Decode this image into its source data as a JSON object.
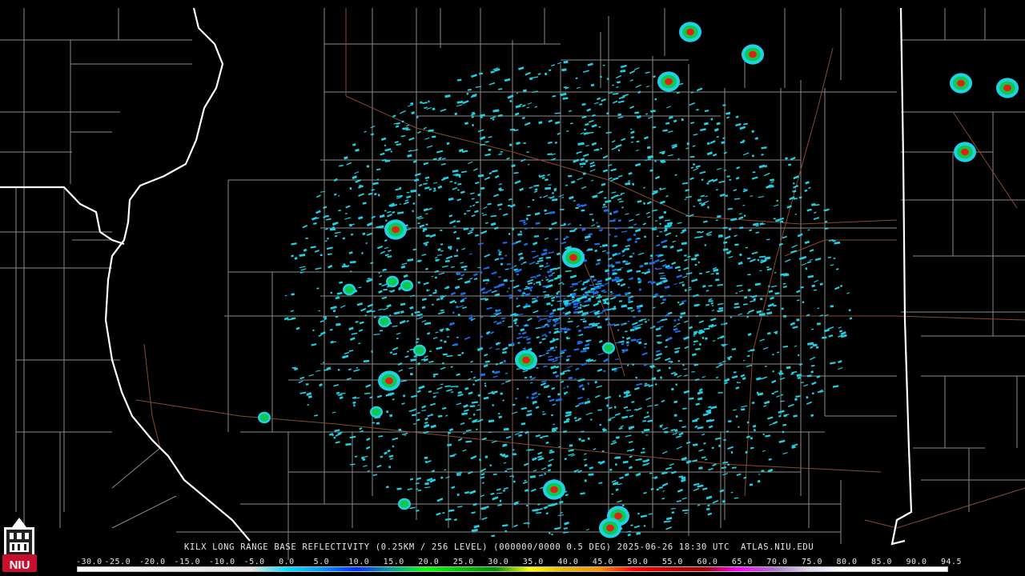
{
  "product": {
    "caption": "KILX LONG RANGE BASE REFLECTIVITY (0.25KM / 256 LEVEL) (000000/0000 0.5 DEG) 2025-06-26 18:30 UTC  ATLAS.NIU.EDU"
  },
  "logo": {
    "text": "NIU",
    "color": "#c8102e"
  },
  "colorbar": {
    "ticks": [
      "-30.0",
      "-25.0",
      "-20.0",
      "-15.0",
      "-10.0",
      "-5.0",
      "0.0",
      "5.0",
      "10.0",
      "15.0",
      "20.0",
      "25.0",
      "30.0",
      "35.0",
      "40.0",
      "45.0",
      "50.0",
      "55.0",
      "60.0",
      "65.0",
      "70.0",
      "75.0",
      "80.0",
      "85.0",
      "90.0",
      "94.5"
    ],
    "stops": [
      "#ffffff",
      "#f5f5f5",
      "#f0f0f0",
      "#ebebeb",
      "#e8e8e8",
      "#e5e5e5",
      "#00e0ff",
      "#009cff",
      "#0030ff",
      "#00a0a0",
      "#00ff00",
      "#00c800",
      "#009000",
      "#ffff00",
      "#e6b400",
      "#ff9000",
      "#ff0000",
      "#c80000",
      "#a00000",
      "#ff00ff",
      "#b070d0",
      "#d8d8e8",
      "#ffffff",
      "#ffffff",
      "#ffffff",
      "#ffffff"
    ]
  },
  "colors": {
    "background": "#000000",
    "county_lines": "#8a8a8a",
    "state_lines": "#ffffff",
    "highways": "#8b4a2b",
    "echo_light": "#1ed2e6",
    "echo_medium": "#1a6ee8",
    "echo_heavy": "#10c850",
    "echo_severe": "#e02010"
  }
}
